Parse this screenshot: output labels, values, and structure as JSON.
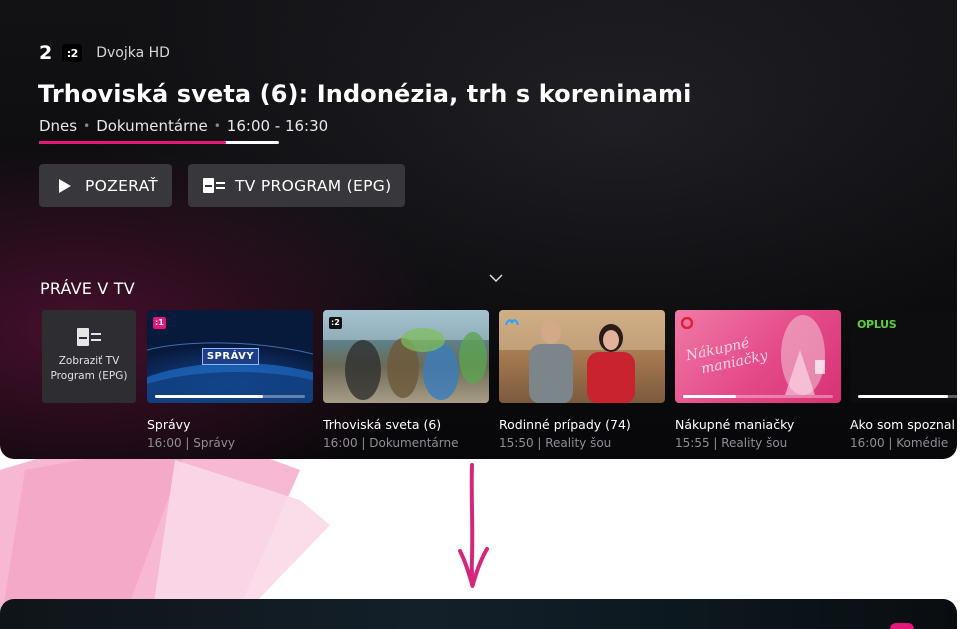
{
  "channel": {
    "number": "2",
    "logo_text": ":2",
    "name": "Dvojka HD"
  },
  "program": {
    "title": "Trhoviská sveta (6): Indonézia, trh s koreninami",
    "day": "Dnes",
    "genre": "Dokumentárne",
    "time": "16:00 - 16:30",
    "progress_fraction": 0.78
  },
  "actions": {
    "watch_label": "POZERAŤ",
    "epg_label": "TV PROGRAM (EPG)"
  },
  "now_on_tv": {
    "heading": "PRÁVE V TV",
    "epg_tile_label_line1": "Zobraziť TV",
    "epg_tile_label_line2": "Program (EPG)",
    "cards": [
      {
        "title": "Správy",
        "subtitle": "16:00 | Správy",
        "badge": ":1",
        "thumb_tag": "SPRÁVY",
        "progress_fraction": 0.72
      },
      {
        "title": "Trhoviská sveta (6)",
        "subtitle": "16:00 | Dokumentárne",
        "badge": ":2",
        "progress_fraction": 0.0
      },
      {
        "title": "Rodinné prípady (74)",
        "subtitle": "15:50 | Reality šou",
        "badge": "",
        "progress_fraction": 0.0
      },
      {
        "title": "Nákupné maniačky",
        "subtitle": "15:55 | Reality šou",
        "badge": "",
        "thumb_text_line1": "Nákupné",
        "thumb_text_line2": "maniačky",
        "progress_fraction": 0.35
      },
      {
        "title": "Ako som spoznal",
        "subtitle": "16:00 | Komédie",
        "logo": "OPLUS",
        "progress_fraction": 0.6
      }
    ]
  },
  "colors": {
    "accent": "#e2197a",
    "button_bg": "#38383c",
    "oplus_green": "#58d23a"
  }
}
